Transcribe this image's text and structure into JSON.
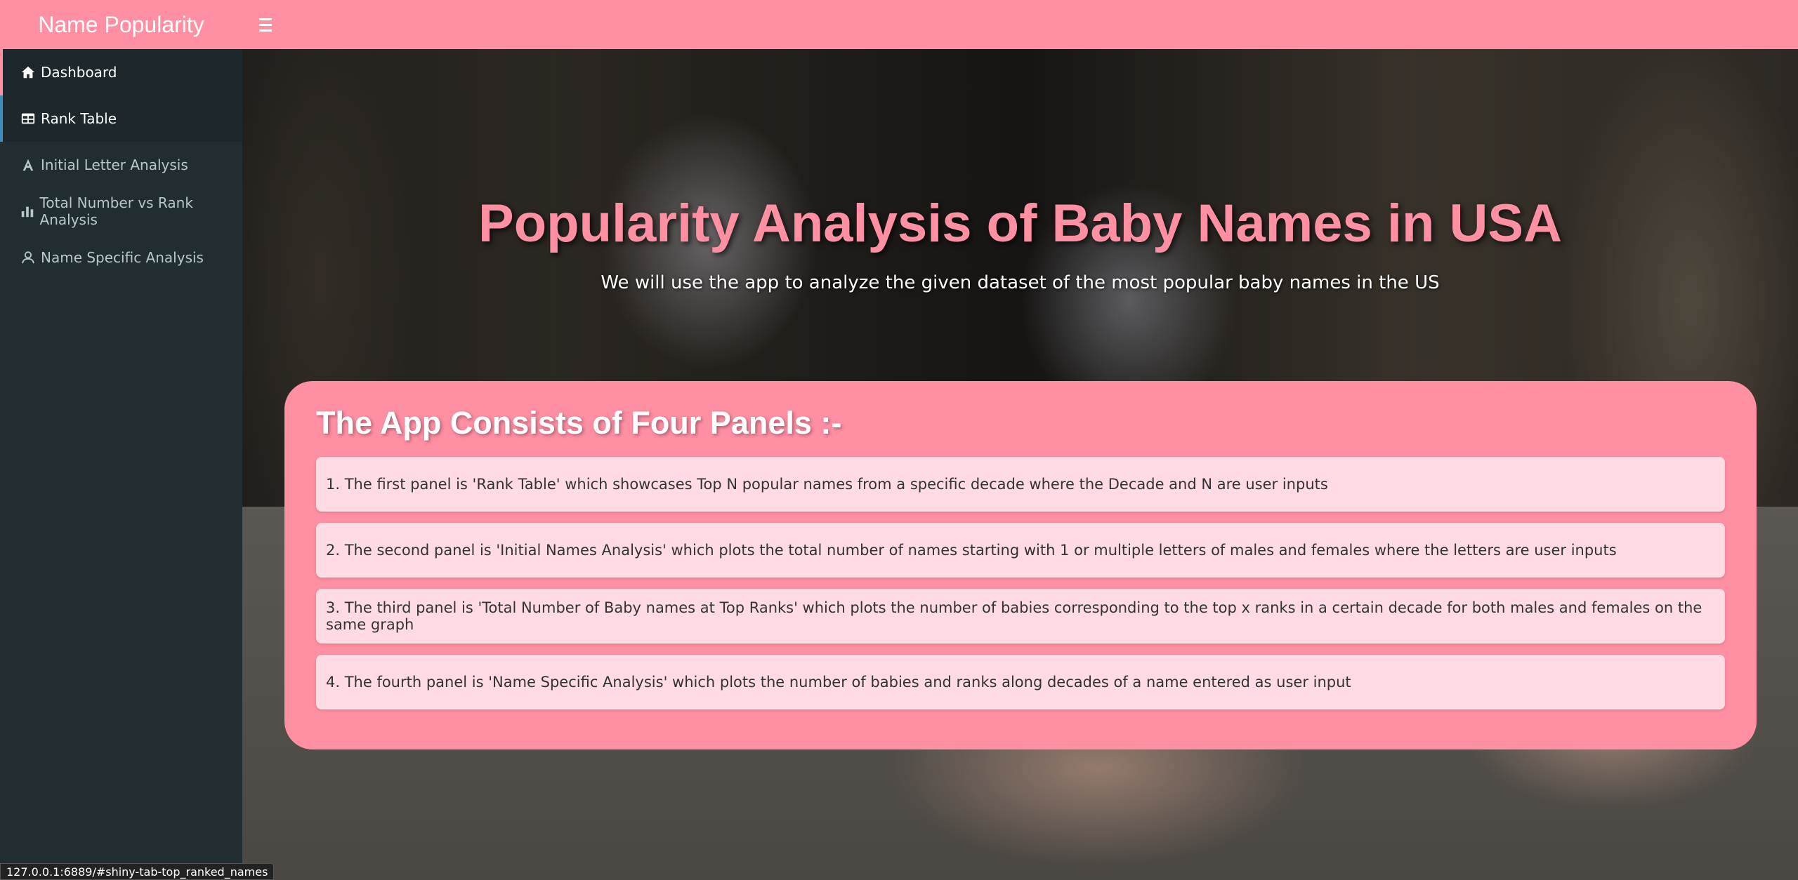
{
  "header": {
    "app_title": "Name Popularity"
  },
  "sidebar": {
    "items": [
      {
        "label": "Dashboard",
        "icon": "home-icon"
      },
      {
        "label": "Rank Table",
        "icon": "table-icon"
      },
      {
        "label": "Initial Letter Analysis",
        "icon": "font-icon"
      },
      {
        "label": "Total Number vs Rank Analysis",
        "icon": "bar-chart-icon"
      },
      {
        "label": "Name Specific Analysis",
        "icon": "user-icon"
      }
    ]
  },
  "hero": {
    "title": "Popularity Analysis of Baby Names in USA",
    "subtitle": "We will use the app to analyze the given dataset of the most popular baby names in the US"
  },
  "panel": {
    "title": "The App Consists of Four Panels :-",
    "items": [
      "1. The first panel is 'Rank Table' which showcases Top N popular names from a specific decade where the Decade and N are user inputs",
      "2. The second panel is 'Initial Names Analysis' which plots the total number of names starting with 1 or multiple letters of males and females where the letters are user inputs",
      "3. The third panel is 'Total Number of Baby names at Top Ranks' which plots the number of babies corresponding to the top x ranks in a certain decade for both males and females on the same graph",
      "4. The fourth panel is 'Name Specific Analysis' which plots the number of babies and ranks along decades of a name entered as user input"
    ]
  },
  "status": {
    "url": "127.0.0.1:6889/#shiny-tab-top_ranked_names"
  },
  "colors": {
    "accent": "#ff8fa3",
    "sidebar_bg": "#222d32",
    "item_bg": "#ffdce3"
  }
}
